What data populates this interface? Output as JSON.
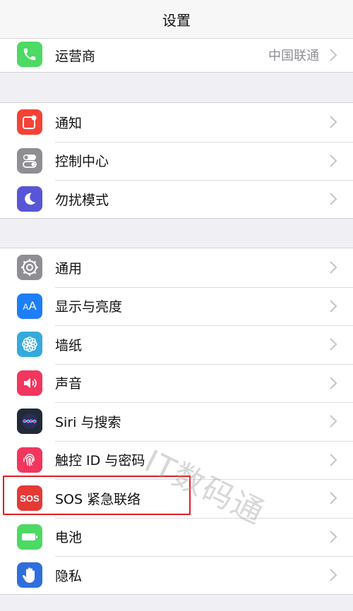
{
  "nav": {
    "title": "设置"
  },
  "carrier": {
    "label": "运营商",
    "value": "中国联通",
    "icon": "phone-icon",
    "color": "#4cd964"
  },
  "group1": [
    {
      "label": "通知",
      "icon": "notifications-icon",
      "color": "#f44336"
    },
    {
      "label": "控制中心",
      "icon": "control-center-icon",
      "color": "#8e8e93"
    },
    {
      "label": "勿扰模式",
      "icon": "moon-icon",
      "color": "#5856d6"
    }
  ],
  "group2": [
    {
      "label": "通用",
      "icon": "gear-icon",
      "color": "#8e8e93"
    },
    {
      "label": "显示与亮度",
      "icon": "display-aa-icon",
      "color": "#1e7ef5",
      "glyph": "AA"
    },
    {
      "label": "墙纸",
      "icon": "wallpaper-flower-icon",
      "color": "#35aadc"
    },
    {
      "label": "声音",
      "icon": "speaker-icon",
      "color": "#f2365e"
    },
    {
      "label": "Siri 与搜索",
      "icon": "siri-icon",
      "color": "#222a3a"
    },
    {
      "label": "触控 ID 与密码",
      "icon": "fingerprint-icon",
      "color": "#f2365e"
    },
    {
      "label": "SOS 紧急联络",
      "icon": "sos-icon",
      "color": "#e53935",
      "glyph": "SOS"
    },
    {
      "label": "电池",
      "icon": "battery-icon",
      "color": "#4cd964"
    },
    {
      "label": "隐私",
      "icon": "hand-icon",
      "color": "#2f6fdc"
    }
  ],
  "watermark": "IT数码通",
  "highlight_color": "#e21c23"
}
